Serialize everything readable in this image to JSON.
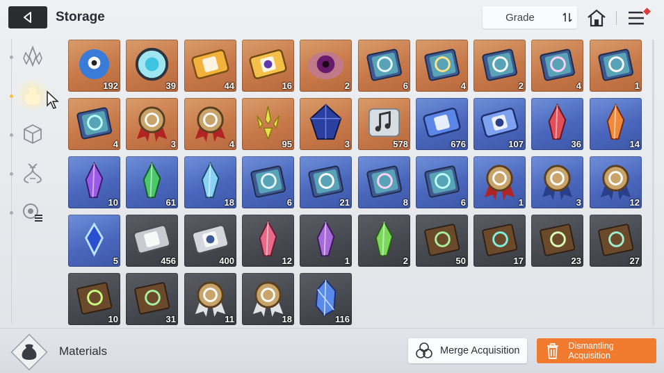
{
  "header": {
    "title": "Storage",
    "sort_label": "Grade"
  },
  "sidebar": {
    "tabs": [
      {
        "name": "crystals",
        "icon": "crystal-cluster-icon"
      },
      {
        "name": "materials",
        "icon": "bag-icon",
        "active": true
      },
      {
        "name": "boxes",
        "icon": "cube-icon"
      },
      {
        "name": "genes",
        "icon": "dna-icon"
      },
      {
        "name": "others",
        "icon": "gear-list-icon"
      }
    ]
  },
  "items": [
    {
      "grade": "orange",
      "icon": "spirit-creature-icon",
      "count": "192"
    },
    {
      "grade": "orange",
      "icon": "core-sphere-icon",
      "count": "39"
    },
    {
      "grade": "orange",
      "icon": "gold-ticket-icon",
      "count": "44"
    },
    {
      "grade": "orange",
      "icon": "gold-chip-icon",
      "count": "16"
    },
    {
      "grade": "orange",
      "icon": "eye-orb-icon",
      "count": "2"
    },
    {
      "grade": "orange",
      "icon": "manual-sword-icon",
      "count": "6"
    },
    {
      "grade": "orange",
      "icon": "manual-shield-icon",
      "count": "4"
    },
    {
      "grade": "orange",
      "icon": "manual-eye-icon",
      "count": "2"
    },
    {
      "grade": "orange",
      "icon": "manual-wing-icon",
      "count": "4"
    },
    {
      "grade": "orange",
      "icon": "manual-bolt-icon",
      "count": "1"
    },
    {
      "grade": "orange",
      "icon": "manual-target-icon",
      "count": "4"
    },
    {
      "grade": "orange",
      "icon": "medal-cross-icon",
      "count": "3"
    },
    {
      "grade": "orange",
      "icon": "medal-target-icon",
      "count": "4"
    },
    {
      "grade": "orange",
      "icon": "gold-shards-icon",
      "count": "95"
    },
    {
      "grade": "orange",
      "icon": "dark-crystal-icon",
      "count": "3"
    },
    {
      "grade": "orange",
      "icon": "music-scroll-icon",
      "count": "578"
    },
    {
      "grade": "blue",
      "icon": "blue-ticket-icon",
      "count": "676"
    },
    {
      "grade": "blue",
      "icon": "blue-chip-icon",
      "count": "107"
    },
    {
      "grade": "blue",
      "icon": "red-crystal-icon",
      "count": "36"
    },
    {
      "grade": "blue",
      "icon": "fire-crystal-icon",
      "count": "14"
    },
    {
      "grade": "blue",
      "icon": "purple-crystal-icon",
      "count": "10"
    },
    {
      "grade": "blue",
      "icon": "green-crystal-icon",
      "count": "61"
    },
    {
      "grade": "blue",
      "icon": "ice-crystal-icon",
      "count": "18"
    },
    {
      "grade": "blue",
      "icon": "manual-sword-icon",
      "count": "6"
    },
    {
      "grade": "blue",
      "icon": "manual-eye-icon",
      "count": "21"
    },
    {
      "grade": "blue",
      "icon": "manual-wing-icon",
      "count": "8"
    },
    {
      "grade": "blue",
      "icon": "manual-target-icon",
      "count": "6"
    },
    {
      "grade": "blue",
      "icon": "medal-cross-icon",
      "count": "1"
    },
    {
      "grade": "blue",
      "icon": "medal-eye-icon",
      "count": "3"
    },
    {
      "grade": "blue",
      "icon": "medal-bolt-icon",
      "count": "12"
    },
    {
      "grade": "blue",
      "icon": "ice-shard-icon",
      "count": "5"
    },
    {
      "grade": "gray",
      "icon": "silver-ticket-icon",
      "count": "456"
    },
    {
      "grade": "gray",
      "icon": "silver-chip-icon",
      "count": "400"
    },
    {
      "grade": "gray",
      "icon": "pink-crystal-icon",
      "count": "12"
    },
    {
      "grade": "gray",
      "icon": "violet-crystal-icon",
      "count": "1"
    },
    {
      "grade": "gray",
      "icon": "lime-crystal-icon",
      "count": "2"
    },
    {
      "grade": "gray",
      "icon": "book-sword-icon",
      "count": "50"
    },
    {
      "grade": "gray",
      "icon": "book-shield-icon",
      "count": "17"
    },
    {
      "grade": "gray",
      "icon": "book-eye-icon",
      "count": "23"
    },
    {
      "grade": "gray",
      "icon": "book-wing-icon",
      "count": "27"
    },
    {
      "grade": "gray",
      "icon": "book-bolt-icon",
      "count": "10"
    },
    {
      "grade": "gray",
      "icon": "book-target-icon",
      "count": "31"
    },
    {
      "grade": "gray",
      "icon": "bronze-medal-cross-icon",
      "count": "11"
    },
    {
      "grade": "gray",
      "icon": "bronze-medal-target-icon",
      "count": "18"
    },
    {
      "grade": "gray",
      "icon": "blue-crystal-cluster-icon",
      "count": "116"
    }
  ],
  "footer": {
    "category_label": "Materials",
    "merge_label": "Merge Acquisition",
    "dismantle_label": "Dismantling Acquisition"
  },
  "colors": {
    "orange_grade": "#c8794a",
    "blue_grade": "#4a67bd",
    "gray_grade": "#45484e",
    "accent": "#f07a2e"
  }
}
